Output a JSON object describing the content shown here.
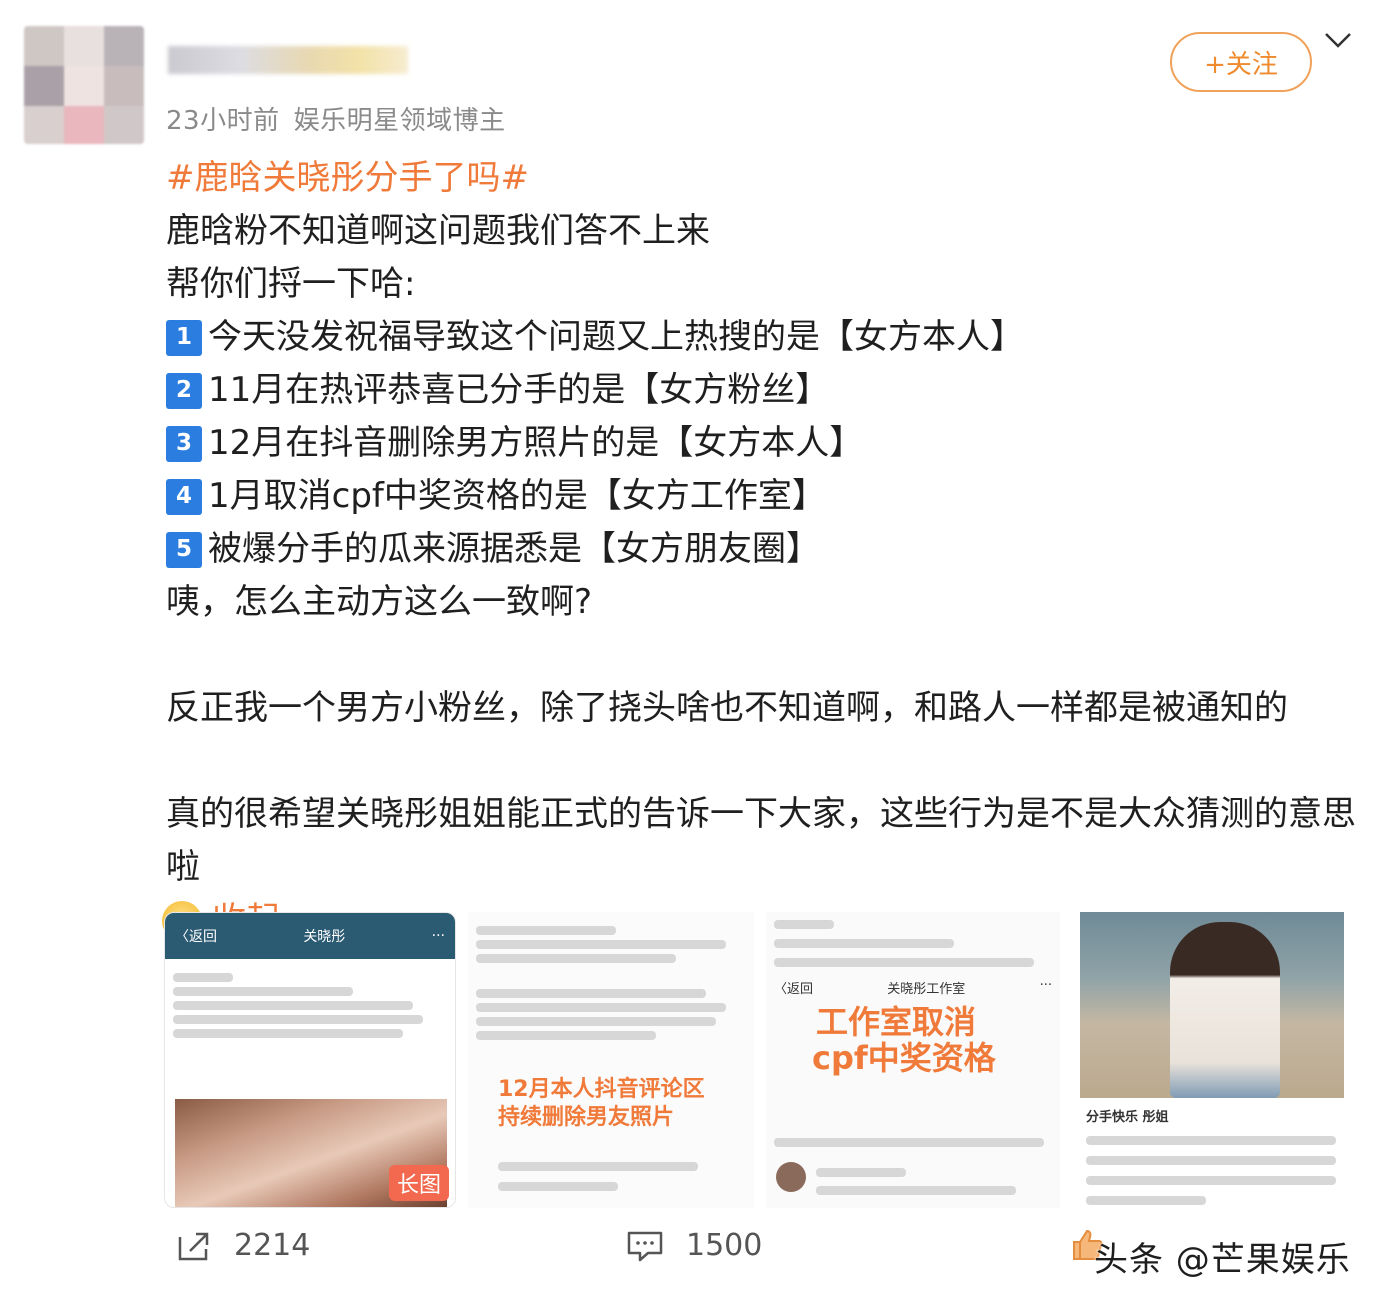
{
  "post": {
    "meta_time": "23小时前",
    "meta_role": "娱乐明星领域博主",
    "follow_label": "+关注",
    "hashtag": "#鹿晗关晓彤分手了吗#",
    "lines": {
      "l1": "鹿晗粉不知道啊这问题我们答不上来",
      "l2": "帮你们捋一下哈:",
      "item1": "今天没发祝福导致这个问题又上热搜的是【女方本人】",
      "item2": "11月在热评恭喜已分手的是【女方粉丝】",
      "item3": "12月在抖音删除男方照片的是【女方本人】",
      "item4": "1月取消cpf中奖资格的是【女方工作室】",
      "item5": "被爆分手的瓜来源据悉是【女方朋友圈】",
      "l3": "咦，怎么主动方这么一致啊?",
      "l4": "反正我一个男方小粉丝，除了挠头啥也不知道啊，和路人一样都是被通知的",
      "l5": "真的很希望关晓彤姐姐能正式的告诉一下大家，这些行为是不是大众猜测的意思啦"
    },
    "badges": [
      "1",
      "2",
      "3",
      "4",
      "5"
    ],
    "collapse_label": "收起"
  },
  "thumbnails": {
    "t1": {
      "back": "〈返回",
      "name": "关晓彤",
      "tag": "长图"
    },
    "t2": {
      "overlay": "12月本人抖音评论区持续删除男友照片"
    },
    "t3": {
      "back": "〈返回",
      "name": "关晓彤工作室",
      "overlay1": "工作室取消",
      "overlay2": "cpf中奖资格"
    },
    "t4": {
      "caption": "分手快乐  彤姐"
    }
  },
  "footer": {
    "share_count": "2214",
    "comment_count": "1500",
    "watermark": "头条 @芒果娱乐"
  },
  "colors": {
    "accent": "#f07a3a",
    "badge_blue": "#2b7de0",
    "follow_border": "#f0a25a"
  },
  "icons": [
    "share-icon",
    "comment-icon",
    "like-icon",
    "chevron-down-icon"
  ]
}
